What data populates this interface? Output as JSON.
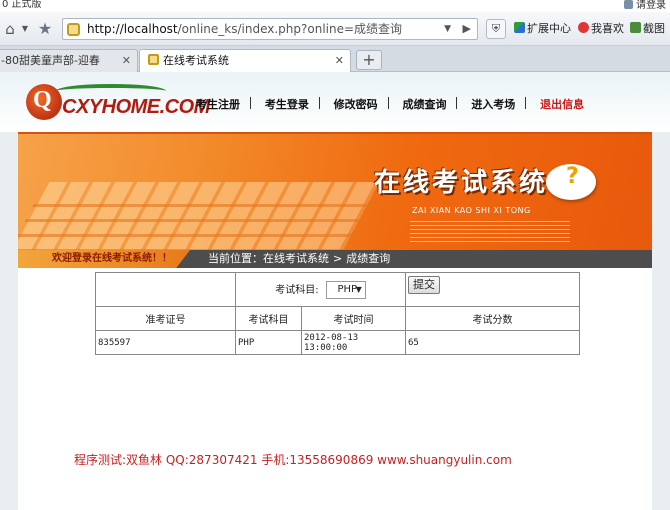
{
  "browser": {
    "version_text": "0 正式版",
    "login_text": "请登录",
    "url_host": "http://localhost",
    "url_path": "/online_ks/index.php?online=成绩查询",
    "toolbar": {
      "extensions": "扩展中心",
      "favorites": "我喜欢",
      "screenshot": "截图"
    },
    "tabs": [
      {
        "title": "-80甜美童声部-迎春",
        "active": false
      },
      {
        "title": "在线考试系统",
        "active": true
      }
    ],
    "new_tab": "+"
  },
  "site": {
    "logo_text": "CXYHOME.COM",
    "nav": [
      {
        "label": "考生注册"
      },
      {
        "label": "考生登录"
      },
      {
        "label": "修改密码"
      },
      {
        "label": "成绩查询"
      },
      {
        "label": "进入考场"
      },
      {
        "label": "退出信息"
      }
    ],
    "banner": {
      "title": "在线考试系统",
      "subtitle": "ZAI XIAN KAO SHI XI TONG",
      "bubble_char": "?"
    },
    "welcome_text": "欢迎登录在线考试系统！！",
    "breadcrumb": {
      "prefix": "当前位置：",
      "root": "在线考试系统",
      "arrow": ">",
      "current": "成绩查询"
    }
  },
  "query": {
    "subject_label": "考试科目:",
    "subject_value": "PHP",
    "submit_label": "提交"
  },
  "results": {
    "columns": [
      "准考证号",
      "考试科目",
      "考试时间",
      "考试分数"
    ],
    "rows": [
      [
        "835597",
        "PHP",
        "2012-08-13 13:00:00",
        "65"
      ]
    ]
  },
  "footer": {
    "credit": "程序测试:双鱼林 QQ:287307421 手机:13558690869 www.shuangyulin.com"
  },
  "colors": {
    "accent_orange": "#f06a10",
    "logout_red": "#c81818",
    "footer_red": "#c82020",
    "info_bar": "#4d4d4d"
  }
}
